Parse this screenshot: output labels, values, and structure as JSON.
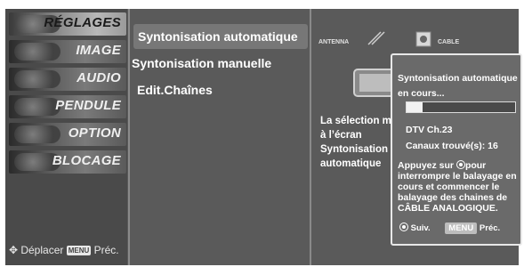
{
  "left_menu": {
    "items": [
      {
        "label": "RÉGLAGES",
        "active": true
      },
      {
        "label": "IMAGE",
        "active": false
      },
      {
        "label": "AUDIO",
        "active": false
      },
      {
        "label": "PENDULE",
        "active": false
      },
      {
        "label": "OPTION",
        "active": false
      },
      {
        "label": "BLOCAGE",
        "active": false
      }
    ],
    "hint_move": "Déplacer",
    "hint_menu_key": "MENU",
    "hint_prev": "Préc."
  },
  "submenu": {
    "items": [
      "Syntonisation automatique",
      "Syntonisation manuelle",
      "Edit.Chaînes"
    ],
    "selected_index": 0
  },
  "info_panel": {
    "antenna_label": "ANTENNA",
    "cable_label": "CABLE",
    "description": "La sélection mène à l’écran Syntonisation automatique"
  },
  "popup": {
    "title": "Syntonisation automatique",
    "status": "en cours...",
    "progress_fraction": 0.15,
    "channel": "DTV Ch.23",
    "found": "Canaux trouvé(s): 16",
    "instruction_prefix": "Appuyez sur",
    "instruction_rest": "pour interrompre le balayage en cours et commencer le balayage des chaines de CÂBLE ANALOGIQUE.",
    "next_label": "Suiv.",
    "menu_key": "MENU",
    "prev_label": "Préc."
  },
  "colors": {
    "screen_bg": "#5a5a5a",
    "popup_bg": "#6a6a6a",
    "selected_bg": "#777777"
  }
}
